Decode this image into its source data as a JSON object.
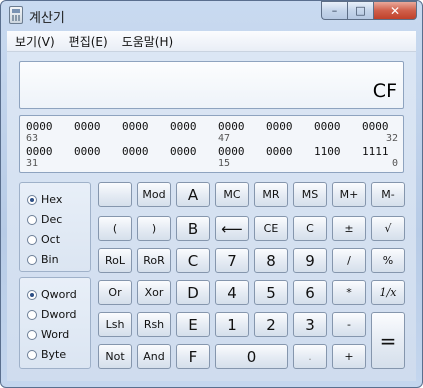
{
  "window": {
    "title": "계산기",
    "caption": {
      "minimize": "–",
      "maximize": "□",
      "close": "✕"
    }
  },
  "menu": {
    "view": "보기(V)",
    "edit": "편집(E)",
    "help": "도움말(H)"
  },
  "display": {
    "value": "CF"
  },
  "bits": {
    "row1": [
      "0000",
      "0000",
      "0000",
      "0000",
      "0000",
      "0000",
      "0000",
      "0000"
    ],
    "row1_pos": {
      "left": "63",
      "mid": "47",
      "right": "32"
    },
    "row2": [
      "0000",
      "0000",
      "0000",
      "0000",
      "0000",
      "0000",
      "1100",
      "1111"
    ],
    "row2_pos": {
      "left": "31",
      "mid": "15",
      "right": "0"
    }
  },
  "number_system": {
    "selected": "Hex",
    "options": [
      "Hex",
      "Dec",
      "Oct",
      "Bin"
    ]
  },
  "word_size": {
    "selected": "Qword",
    "options": [
      "Qword",
      "Dword",
      "Word",
      "Byte"
    ]
  },
  "keys": {
    "mod": "Mod",
    "a": "A",
    "mc": "MC",
    "mr": "MR",
    "ms": "MS",
    "mplus": "M+",
    "mminus": "M-",
    "lparen": "(",
    "rparen": ")",
    "b": "B",
    "back": "⟵",
    "ce": "CE",
    "c": "C",
    "pm": "±",
    "sqrt": "√",
    "rol": "RoL",
    "ror": "RoR",
    "hc": "C",
    "n7": "7",
    "n8": "8",
    "n9": "9",
    "div": "/",
    "pct": "%",
    "or": "Or",
    "xor": "Xor",
    "d": "D",
    "n4": "4",
    "n5": "5",
    "n6": "6",
    "mul": "*",
    "recip": "1/x",
    "lsh": "Lsh",
    "rsh": "Rsh",
    "e": "E",
    "n1": "1",
    "n2": "2",
    "n3": "3",
    "sub": "-",
    "eq": "=",
    "not": "Not",
    "and": "And",
    "f": "F",
    "n0": "0",
    "dot": ".",
    "add": "+"
  }
}
